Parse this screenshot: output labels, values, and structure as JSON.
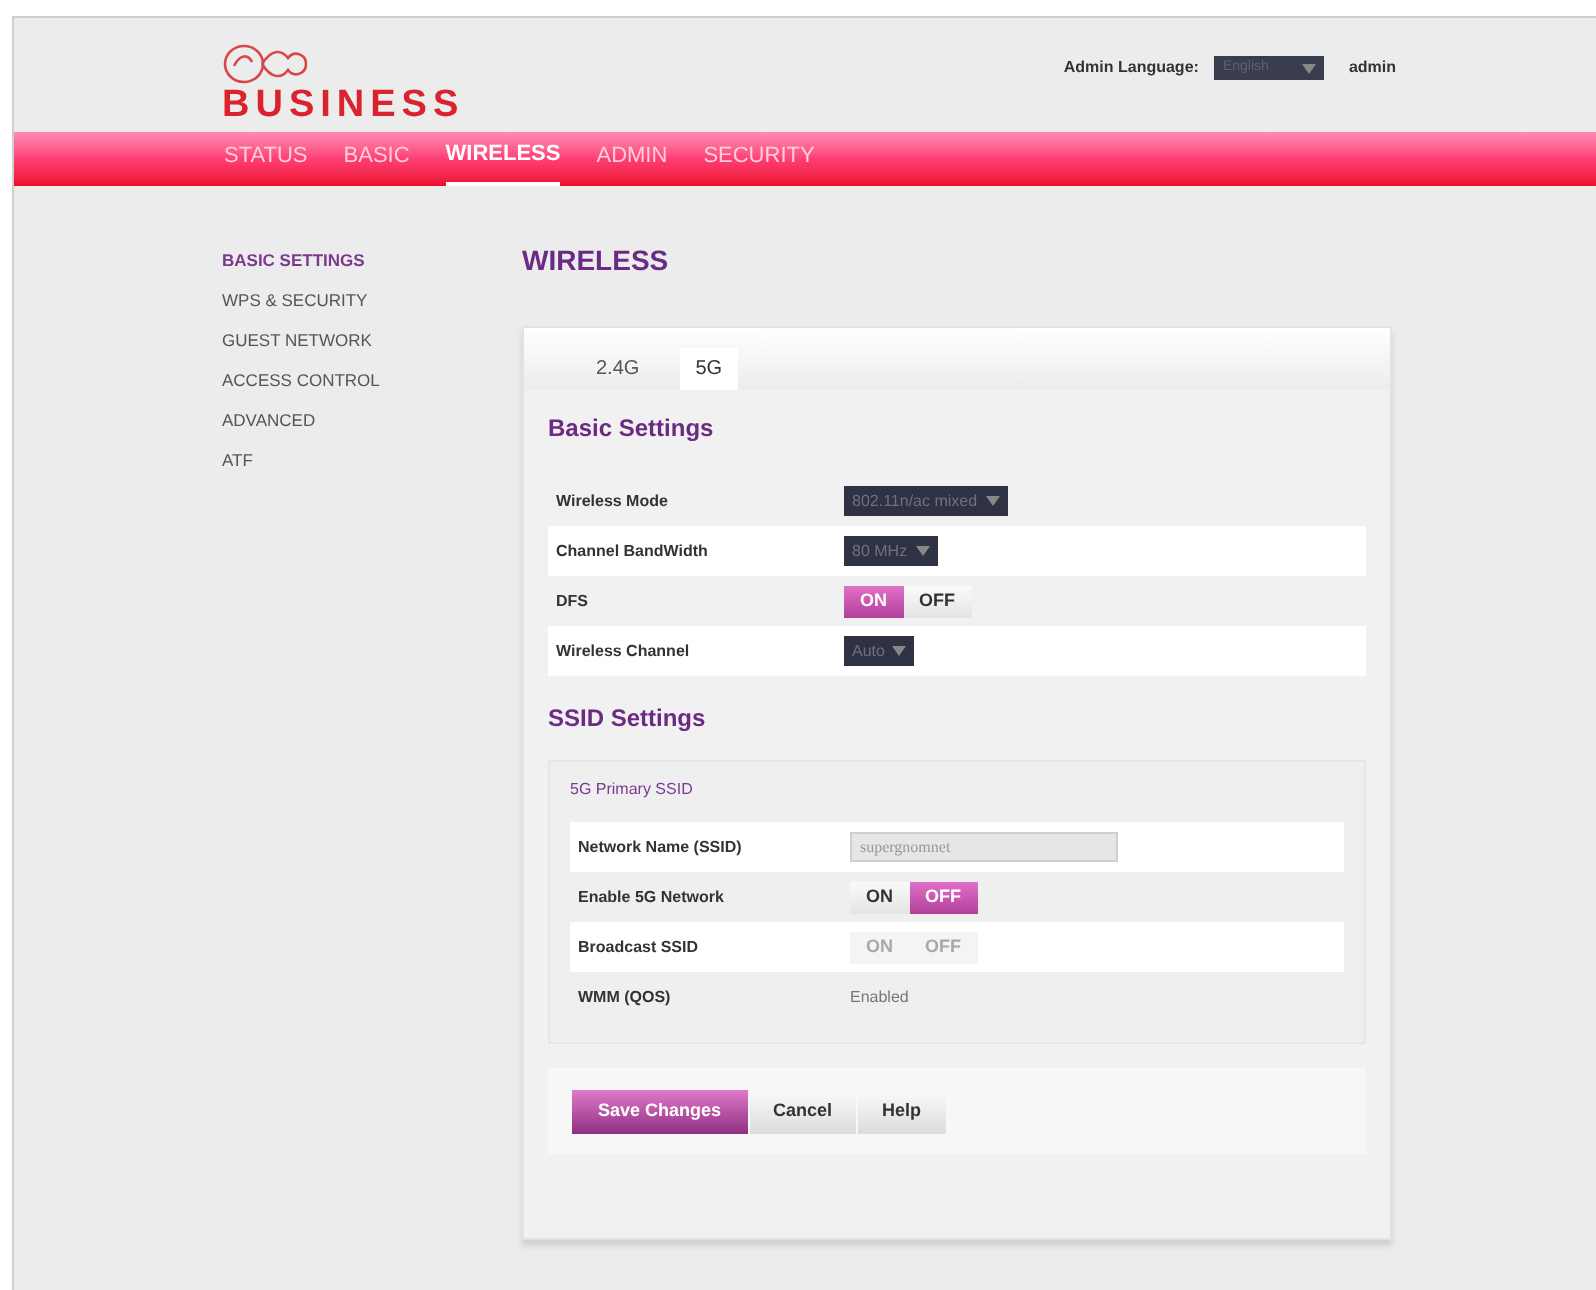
{
  "header": {
    "brand": "BUSINESS",
    "language_label": "Admin Language:",
    "language": "English",
    "user": "admin"
  },
  "nav": [
    {
      "label": "STATUS",
      "selected": false
    },
    {
      "label": "BASIC",
      "selected": false
    },
    {
      "label": "WIRELESS",
      "selected": true
    },
    {
      "label": "ADMIN",
      "selected": false
    },
    {
      "label": "SECURITY",
      "selected": false
    }
  ],
  "sidebar": [
    {
      "label": "BASIC SETTINGS",
      "selected": true
    },
    {
      "label": "WPS & SECURITY",
      "selected": false
    },
    {
      "label": "GUEST NETWORK",
      "selected": false
    },
    {
      "label": "ACCESS CONTROL",
      "selected": false
    },
    {
      "label": "ADVANCED",
      "selected": false
    },
    {
      "label": "ATF",
      "selected": false
    }
  ],
  "page_title": "WIRELESS",
  "tabs": [
    {
      "label": "2.4G",
      "selected": false
    },
    {
      "label": "5G",
      "selected": true
    }
  ],
  "basic_settings": {
    "title": "Basic Settings",
    "rows": [
      {
        "kind": "select",
        "label": "Wireless Mode",
        "value": "802.11n/ac mixed"
      },
      {
        "kind": "select",
        "label": "Channel BandWidth",
        "value": "80 MHz"
      },
      {
        "kind": "toggle",
        "label": "DFS",
        "disabled": false,
        "options": [
          {
            "label": "ON",
            "selected": true
          },
          {
            "label": "OFF",
            "selected": false
          }
        ]
      },
      {
        "kind": "select",
        "label": "Wireless Channel",
        "value": "Auto"
      }
    ]
  },
  "ssid_settings": {
    "title": "SSID Settings",
    "group_title": "5G Primary SSID",
    "rows": [
      {
        "kind": "field",
        "label": "Network Name (SSID)",
        "value": "supergnomnet"
      },
      {
        "kind": "toggle",
        "label": "Enable 5G Network",
        "disabled": false,
        "options": [
          {
            "label": "ON",
            "selected": false
          },
          {
            "label": "OFF",
            "selected": true
          }
        ]
      },
      {
        "kind": "toggle",
        "label": "Broadcast SSID",
        "disabled": true,
        "options": [
          {
            "label": "ON",
            "selected": false
          },
          {
            "label": "OFF",
            "selected": false
          }
        ]
      },
      {
        "kind": "text",
        "label": "WMM (QOS)",
        "value": "Enabled"
      }
    ]
  },
  "buttons": [
    {
      "label": "Save Changes",
      "kind": "primary"
    },
    {
      "label": "Cancel",
      "kind": "secondary"
    },
    {
      "label": "Help",
      "kind": "secondary"
    }
  ]
}
